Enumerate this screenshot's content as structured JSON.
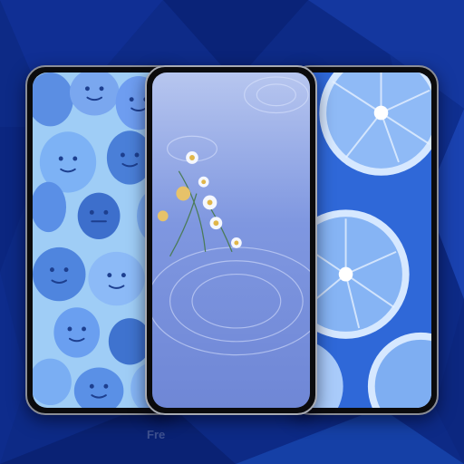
{
  "promo": {
    "background_color": "#0d2a86",
    "accent_color": "#6a9cf0",
    "wallpapers": [
      {
        "theme": "blue-smiley-faces",
        "icon": "smiley-icon"
      },
      {
        "theme": "blue-water-daisies",
        "icon": "flower-icon"
      },
      {
        "theme": "blue-lemon-slices",
        "icon": "lemon-icon"
      }
    ],
    "watermark_text": "Fre"
  }
}
